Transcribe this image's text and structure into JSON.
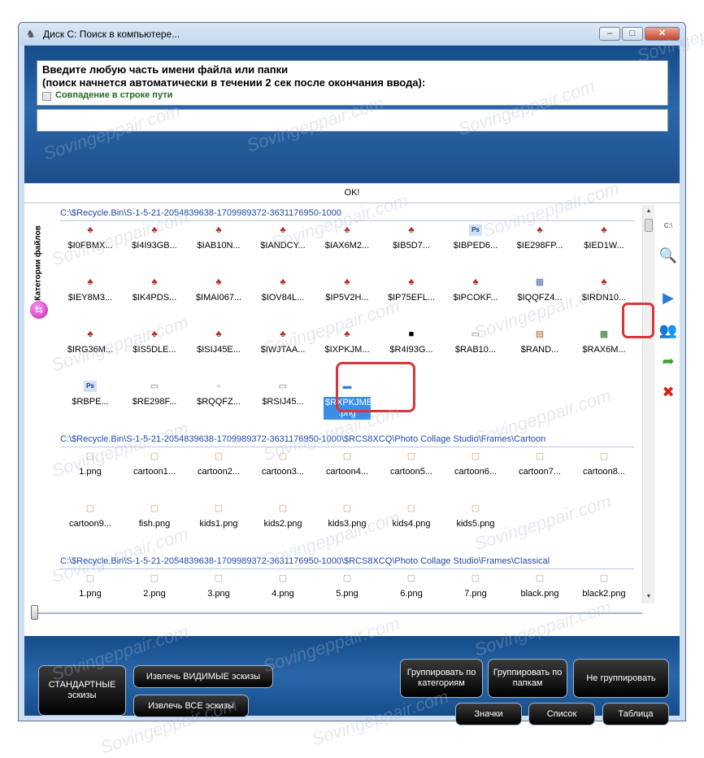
{
  "window": {
    "title": "Диск C: Поиск в компьютере...",
    "minimize": "–",
    "maximize": "□",
    "close": "✕"
  },
  "search": {
    "prompt_line1": "Введите любую часть имени файла или папки",
    "prompt_line2": "(поиск начнется автоматически в течении 2 сек после окончания ввода):",
    "path_match_label": "Совпадение в строке пути",
    "path_match_checked": false,
    "query": ""
  },
  "ok_label": "OK!",
  "categories_label": "Категории файлов",
  "groups": [
    {
      "path": "C:\\$Recycle.Bin\\S-1-5-21-2054839638-1709989372-3631176950-1000",
      "files": [
        {
          "name": "$I0FBMX...",
          "icon": "cards-icon"
        },
        {
          "name": "$I4I93GB...",
          "icon": "cards-icon"
        },
        {
          "name": "$IAB10N...",
          "icon": "cards-icon"
        },
        {
          "name": "$IANDCY...",
          "icon": "cards-icon"
        },
        {
          "name": "$IAX6M2...",
          "icon": "cards-icon"
        },
        {
          "name": "$IB5D7...",
          "icon": "cards-icon"
        },
        {
          "name": "$IBPED6...",
          "icon": "photoshop-icon"
        },
        {
          "name": "$IE298FP...",
          "icon": "cards-icon"
        },
        {
          "name": "$IED1W...",
          "icon": "cards-icon"
        },
        {
          "name": "$IEY8M3...",
          "icon": "cards-icon"
        },
        {
          "name": "$IK4PDS...",
          "icon": "cards-icon"
        },
        {
          "name": "$IMAI067...",
          "icon": "cards-icon"
        },
        {
          "name": "$IOV84L...",
          "icon": "cards-icon"
        },
        {
          "name": "$IP5V2H...",
          "icon": "cards-icon"
        },
        {
          "name": "$IP75EFL...",
          "icon": "cards-icon"
        },
        {
          "name": "$IPCOKF...",
          "icon": "cards-icon"
        },
        {
          "name": "$IQQFZ4...",
          "icon": "image-icon"
        },
        {
          "name": "$IRDN10...",
          "icon": "cards-icon"
        },
        {
          "name": "$IRG36M...",
          "icon": "cards-icon"
        },
        {
          "name": "$IS5DLE...",
          "icon": "cards-icon"
        },
        {
          "name": "$ISIJ45E...",
          "icon": "cards-icon"
        },
        {
          "name": "$IWJTAA...",
          "icon": "cards-icon"
        },
        {
          "name": "$IXPKJM...",
          "icon": "cards-icon"
        },
        {
          "name": "$R4I93G...",
          "icon": "black-image-icon"
        },
        {
          "name": "$RAB10...",
          "icon": "window-image-icon"
        },
        {
          "name": "$RAND...",
          "icon": "document-image-icon"
        },
        {
          "name": "$RAX6M...",
          "icon": "green-image-icon"
        },
        {
          "name": "$RBPE...",
          "icon": "photoshop-icon"
        },
        {
          "name": "$RE298F...",
          "icon": "window-image-icon"
        },
        {
          "name": "$RQQFZ...",
          "icon": "small-image-icon"
        },
        {
          "name": "$RSIJ45...",
          "icon": "window-image-icon"
        },
        {
          "name": "$RXPKJMB .png",
          "icon": "blue-image-icon",
          "selected": true
        }
      ]
    },
    {
      "path": "C:\\$Recycle.Bin\\S-1-5-21-2054839638-1709989372-3631176950-1000\\$RCS8XCQ\\Photo Collage Studio\\Frames\\Cartoon",
      "files": [
        {
          "name": "1.png",
          "icon": "frame-icon"
        },
        {
          "name": "cartoon1...",
          "icon": "frame-icon"
        },
        {
          "name": "cartoon2...",
          "icon": "frame-icon"
        },
        {
          "name": "cartoon3...",
          "icon": "frame-icon"
        },
        {
          "name": "cartoon4...",
          "icon": "frame-icon"
        },
        {
          "name": "cartoon5...",
          "icon": "frame-icon"
        },
        {
          "name": "cartoon6...",
          "icon": "frame-icon"
        },
        {
          "name": "cartoon7...",
          "icon": "frame-icon"
        },
        {
          "name": "cartoon8...",
          "icon": "frame-icon"
        },
        {
          "name": "cartoon9...",
          "icon": "frame-icon"
        },
        {
          "name": "fish.png",
          "icon": "frame-icon"
        },
        {
          "name": "kids1.png",
          "icon": "frame-icon"
        },
        {
          "name": "kids2.png",
          "icon": "frame-icon"
        },
        {
          "name": "kids3.png",
          "icon": "frame-icon"
        },
        {
          "name": "kids4.png",
          "icon": "frame-icon"
        },
        {
          "name": "kids5.png",
          "icon": "frame-icon"
        }
      ]
    },
    {
      "path": "C:\\$Recycle.Bin\\S-1-5-21-2054839638-1709989372-3631176950-1000\\$RCS8XCQ\\Photo Collage Studio\\Frames\\Classical",
      "files": [
        {
          "name": "1.png",
          "icon": "frame-icon"
        },
        {
          "name": "2.png",
          "icon": "frame-icon"
        },
        {
          "name": "3.png",
          "icon": "frame-icon"
        },
        {
          "name": "4.png",
          "icon": "frame-icon"
        },
        {
          "name": "5.png",
          "icon": "frame-icon"
        },
        {
          "name": "6.png",
          "icon": "frame-icon"
        },
        {
          "name": "7.png",
          "icon": "frame-icon"
        },
        {
          "name": "black.png",
          "icon": "frame-icon"
        },
        {
          "name": "black2.png",
          "icon": "frame-icon"
        }
      ]
    }
  ],
  "tools": [
    {
      "name": "console-icon",
      "glyph": "C:\\"
    },
    {
      "name": "search-zoom-icon",
      "glyph": "🔍"
    },
    {
      "name": "play-icon",
      "glyph": "▶"
    },
    {
      "name": "users-icon",
      "glyph": "👥"
    },
    {
      "name": "forward-arrow-icon",
      "glyph": "➦"
    },
    {
      "name": "delete-icon",
      "glyph": "✖"
    }
  ],
  "buttons": {
    "standard_thumbs": "СТАНДАРТНЫЕ эскизы",
    "extract_visible": "Извлечь ВИДИМЫЕ эскизы",
    "extract_all": "Извлечь ВСЕ эскизы",
    "group_by_category": "Группировать по категориям",
    "group_by_folder": "Группировать по папкам",
    "no_group": "Не группировать",
    "icons": "Значки",
    "list": "Список",
    "table": "Таблица"
  },
  "watermark": "Sovingeppair.com",
  "colors": {
    "panel_blue": "#1d4d8a",
    "selection_blue": "#3a8ee6",
    "highlight_red": "#d9363b",
    "group_header_blue": "#1f4aa8"
  }
}
